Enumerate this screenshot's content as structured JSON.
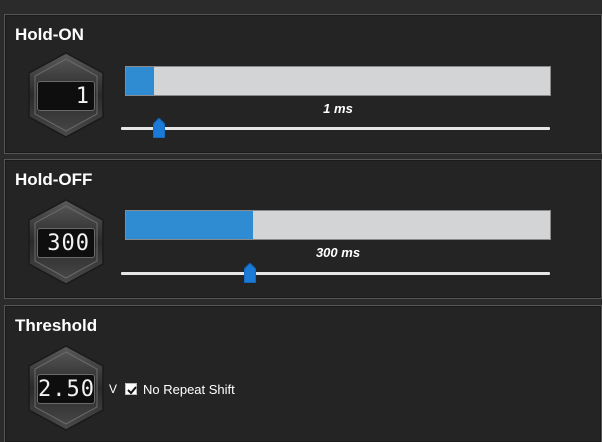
{
  "hold_on": {
    "title": "Hold-ON",
    "display_value": "1",
    "value_label": "1 ms",
    "bar_fill_fraction": 0.066,
    "slider_fraction": 0.089
  },
  "hold_off": {
    "title": "Hold-OFF",
    "display_value": "300",
    "value_label": "300 ms",
    "bar_fill_fraction": 0.3,
    "slider_fraction": 0.3
  },
  "threshold": {
    "title": "Threshold",
    "display_value": "2.50",
    "unit": "V",
    "checkbox_label": "No Repeat Shift",
    "checkbox_checked": true
  },
  "colors": {
    "accent": "#2f8bd2",
    "thumb": "#1a7ad6",
    "track": "#d2d4d6"
  }
}
